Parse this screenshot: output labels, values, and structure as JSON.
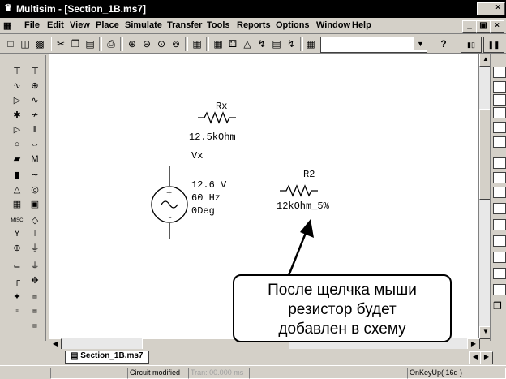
{
  "window": {
    "title": "Multisim - [Section_1B.ms7]",
    "controls": [
      "_",
      "×"
    ]
  },
  "menu": [
    {
      "label": "File"
    },
    {
      "label": "Edit"
    },
    {
      "label": "View"
    },
    {
      "label": "Place"
    },
    {
      "label": "Simulate"
    },
    {
      "label": "Transfer"
    },
    {
      "label": "Tools"
    },
    {
      "label": "Reports"
    },
    {
      "label": "Options"
    },
    {
      "label": "Window"
    },
    {
      "label": "Help"
    }
  ],
  "toolbar": {
    "combo_value": "",
    "help_label": "?"
  },
  "schematic": {
    "rx": {
      "ref": "Rx",
      "value": "12.5kOhm"
    },
    "vx": {
      "ref": "Vx",
      "voltage": "12.6 V",
      "frequency": "60 Hz",
      "phase": "0Deg"
    },
    "r2": {
      "ref": "R2",
      "value": "12kOhm_5%"
    }
  },
  "callout": {
    "line1": "После щелчка мыши",
    "line2": "резистор будет",
    "line3": "добавлен в схему"
  },
  "tabs": [
    {
      "label": "Section_1B.ms7"
    }
  ],
  "status": {
    "circuit": "Circuit modified",
    "tran": "Tran: 00.000 ms",
    "key": "OnKeyUp( 16d )"
  }
}
